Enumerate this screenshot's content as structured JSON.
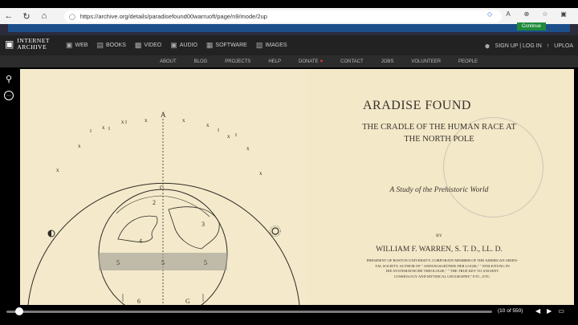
{
  "browser": {
    "url": "https://archive.org/details/paradisefound00warruoft/page/n9/mode/2up"
  },
  "banner": {
    "continue_label": "Continue"
  },
  "ia": {
    "logo_line1": "INTERNET",
    "logo_line2": "ARCHIVE",
    "media": [
      "WEB",
      "BOOKS",
      "VIDEO",
      "AUDIO",
      "SOFTWARE",
      "IMAGES"
    ],
    "signin": "SIGN UP | LOG IN",
    "upload": "UPLOA",
    "subnav": [
      "ABOUT",
      "BLOG",
      "PROJECTS",
      "HELP",
      "DONATE",
      "CONTACT",
      "JOBS",
      "VOLUNTEER",
      "PEOPLE"
    ]
  },
  "book": {
    "title": "ARADISE FOUND",
    "subtitle1": "THE CRADLE OF THE HUMAN RACE AT",
    "subtitle2": "THE NORTH POLE",
    "study": "A Study of the Prehistoric World",
    "by": "BY",
    "author": "WILLIAM F. WARREN, S. T. D., LL. D.",
    "affil1": "PRESIDENT OF BOSTON UNIVERSITY, CORPORATE MEMBER OF THE AMERICAN ORIEN-",
    "affil2": "TAL SOCIETY, AUTHOR OF \" ANFANGSGRÜNDE DER LOGIK,\" \" EINLEITUNG IN",
    "affil3": "DIE SYSTEMATISCHE THEOLOGIE,\" \" THE TRUE KEY TO ANCIENT",
    "affil4": "COSMOLOGY AND MYTHICAL GEOGRAPHY,\" ETC., ETC."
  },
  "diagram": {
    "top_label": "A",
    "c_label": "C",
    "labels": [
      "2",
      "3",
      "4",
      "5",
      "5",
      "5",
      "6",
      "G"
    ]
  },
  "reader": {
    "page_count": "(10 of 550)",
    "progress": 0.018
  }
}
